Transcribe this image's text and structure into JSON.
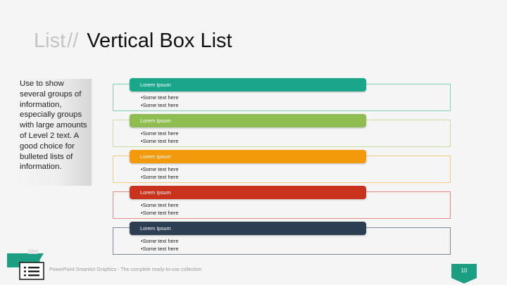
{
  "title": {
    "prefix": "List",
    "separator": "//",
    "main": "Vertical Box List"
  },
  "description": "Use to show several groups of information, especially groups with large amounts of Level 2 text. A good choice for bulleted lists of information.",
  "groups": [
    {
      "header": "Lorem Ipsum",
      "bullets": [
        "•Some text here",
        "•Some text here"
      ],
      "header_color": "#1aa68a",
      "border_color": "#7fcfba"
    },
    {
      "header": "Lorem Ipsum",
      "bullets": [
        "•Some text here",
        "•Some text here"
      ],
      "header_color": "#8fbd4f",
      "border_color": "#c6de9e"
    },
    {
      "header": "Lorem Ipsum",
      "bullets": [
        "•Some text here",
        "•Some text here"
      ],
      "header_color": "#f39a0c",
      "border_color": "#f6c77f"
    },
    {
      "header": "Lorem Ipsum",
      "bullets": [
        "•Some text here",
        "•Some text here"
      ],
      "header_color": "#c9331e",
      "border_color": "#e38a7d"
    },
    {
      "header": "Lorem Ipsum",
      "bullets": [
        "•Some text here",
        "•Some text here"
      ],
      "header_color": "#2c3e52",
      "border_color": "#7c8894"
    }
  ],
  "footer": {
    "tag": "Idea",
    "text": "PowerPoint SmartArt Graphics - The complete ready-to-use collection",
    "page_number": "10"
  },
  "colors": {
    "accent": "#1b9e82",
    "title_gray": "#c4c4c4"
  },
  "icons": {
    "footer_icon": "list-document-icon",
    "page_badge": "pentagon-badge-icon"
  }
}
